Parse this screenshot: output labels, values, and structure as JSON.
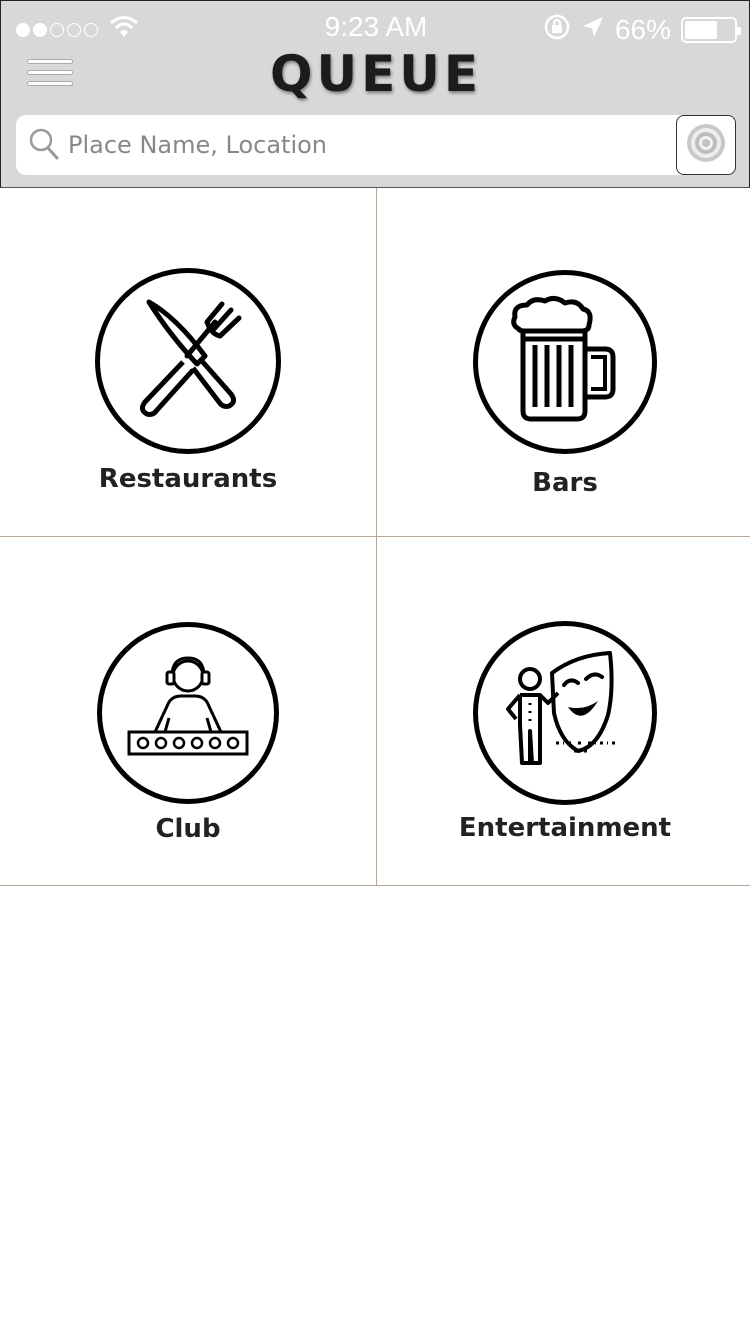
{
  "status_bar": {
    "signal_bars_filled": 2,
    "signal_bars_total": 5,
    "time": "9:23 AM",
    "battery_percent": "66%",
    "battery_level": 0.66
  },
  "header": {
    "title": "QUEUE",
    "menu_icon": "hamburger-menu-icon",
    "background": "#d8d8d8"
  },
  "search": {
    "placeholder": "Place Name, Location",
    "value": "",
    "locate_icon": "target-icon"
  },
  "categories": [
    {
      "label": "Restaurants",
      "icon": "fork-knife-icon"
    },
    {
      "label": "Bars",
      "icon": "beer-mug-icon"
    },
    {
      "label": "Club",
      "icon": "dj-icon"
    },
    {
      "label": "Entertainment",
      "icon": "theater-mask-icon"
    }
  ]
}
